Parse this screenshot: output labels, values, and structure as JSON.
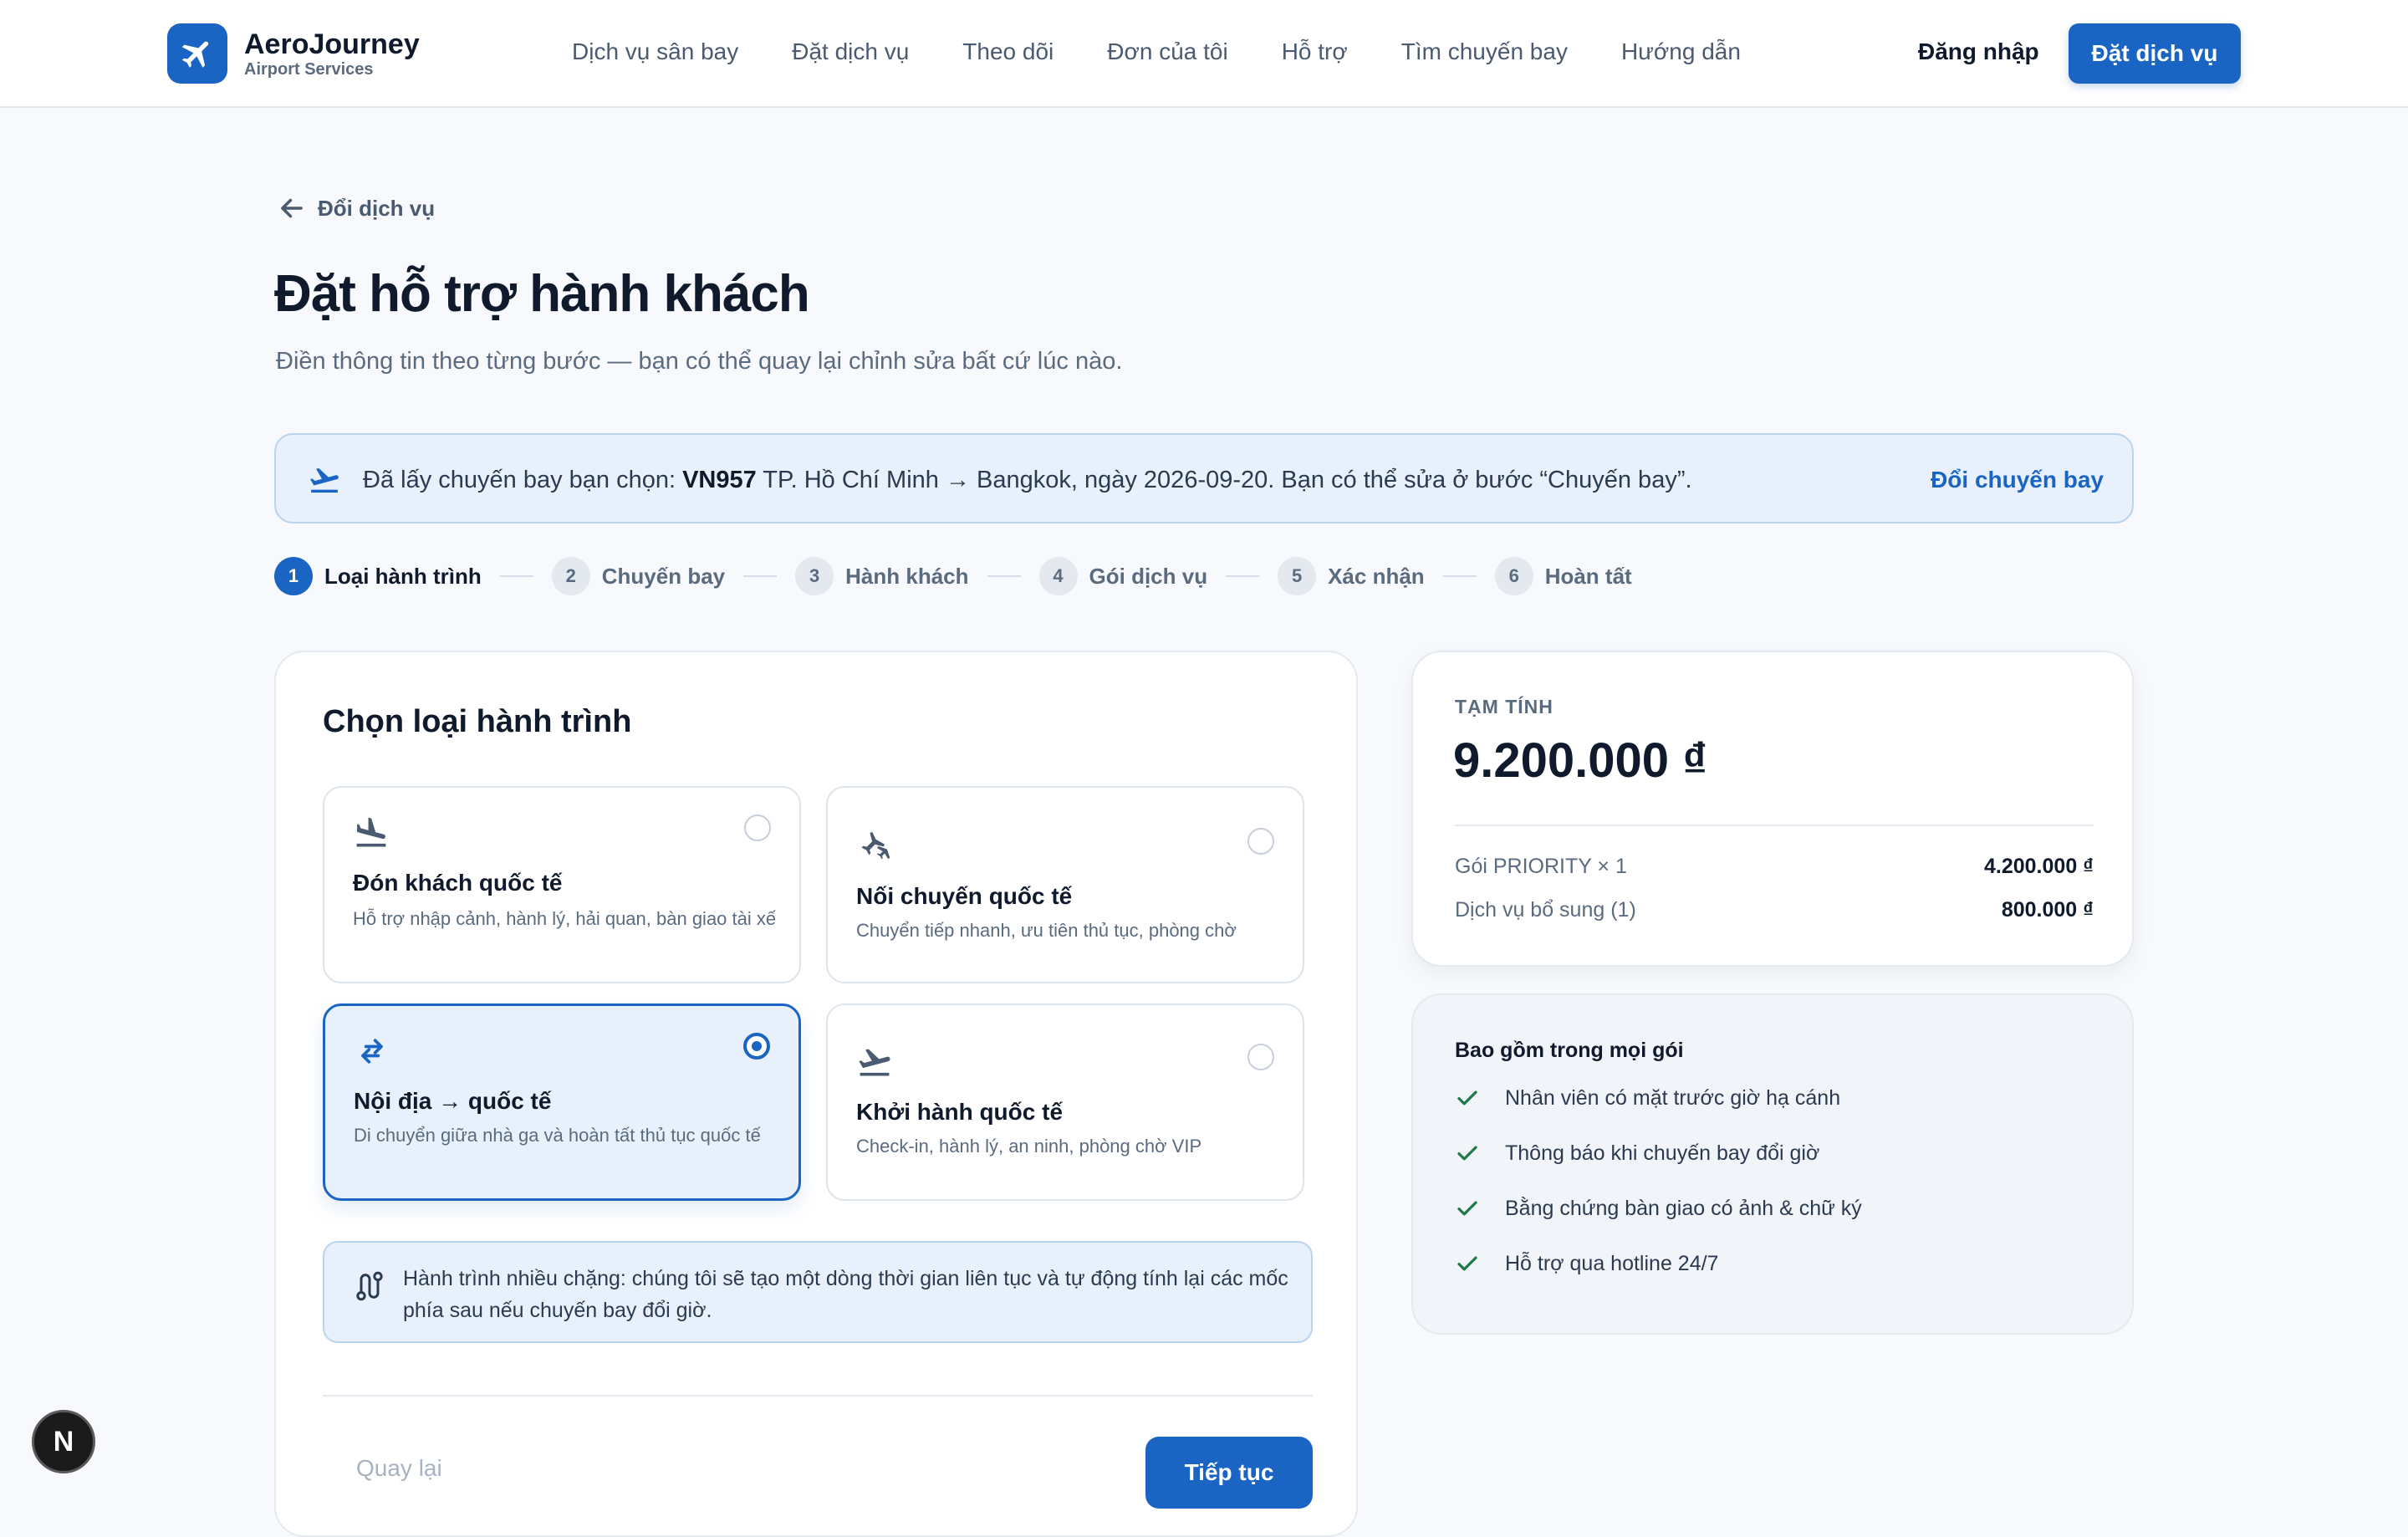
{
  "header": {
    "brand_name": "AeroJourney",
    "brand_sub": "Airport Services",
    "nav": [
      "Dịch vụ sân bay",
      "Đặt dịch vụ",
      "Theo dõi",
      "Đơn của tôi",
      "Hỗ trợ",
      "Tìm chuyến bay",
      "Hướng dẫn"
    ],
    "login": "Đăng nhập",
    "cta": "Đặt dịch vụ"
  },
  "page": {
    "back_label": "Đổi dịch vụ",
    "title": "Đặt hỗ trợ hành khách",
    "subtitle": "Điền thông tin theo từng bước — bạn có thể quay lại chỉnh sửa bất cứ lúc nào."
  },
  "banner": {
    "prefix": "Đã lấy chuyến bay bạn chọn: ",
    "flight": "VN957",
    "suffix": " TP. Hồ Chí Minh → Bangkok, ngày 2026-09-20. Bạn có thể sửa ở bước “Chuyến bay”.",
    "link": "Đổi chuyến bay"
  },
  "steps": [
    {
      "num": "1",
      "label": "Loại hành trình"
    },
    {
      "num": "2",
      "label": "Chuyến bay"
    },
    {
      "num": "3",
      "label": "Hành khách"
    },
    {
      "num": "4",
      "label": "Gói dịch vụ"
    },
    {
      "num": "5",
      "label": "Xác nhận"
    },
    {
      "num": "6",
      "label": "Hoàn tất"
    }
  ],
  "card": {
    "title": "Chọn loại hành trình",
    "options": [
      {
        "title": "Đón khách quốc tế",
        "desc": "Hỗ trợ nhập cảnh, hành lý, hải quan, bàn giao tài xế",
        "icon": "plane-landing-icon"
      },
      {
        "title": "Nối chuyến quốc tế",
        "desc": "Chuyển tiếp nhanh, ưu tiên thủ tục, phòng chờ",
        "icon": "connecting-flight-icon"
      },
      {
        "title": "Nội địa → quốc tế",
        "desc": "Di chuyển giữa nhà ga và hoàn tất thủ tục quốc tế",
        "icon": "swap-arrows-icon"
      },
      {
        "title": "Khởi hành quốc tế",
        "desc": "Check-in, hành lý, an ninh, phòng chờ VIP",
        "icon": "plane-takeoff-icon"
      }
    ],
    "selected_index": 2,
    "note": "Hành trình nhiều chặng: chúng tôi sẽ tạo một dòng thời gian liên tục và tự động tính lại các mốc phía sau nếu chuyến bay đổi giờ.",
    "back_button": "Quay lại",
    "next_button": "Tiếp tục"
  },
  "summary": {
    "label": "TẠM TÍNH",
    "total": "9.200.000 ₫",
    "rows": [
      {
        "label": "Gói PRIORITY × 1",
        "value": "4.200.000 ₫"
      },
      {
        "label": "Dịch vụ bổ sung (1)",
        "value": "800.000 ₫"
      }
    ]
  },
  "included": {
    "title": "Bao gồm trong mọi gói",
    "items": [
      "Nhân viên có mặt trước giờ hạ cánh",
      "Thông báo khi chuyến bay đổi giờ",
      "Bằng chứng bàn giao có ảnh & chữ ký",
      "Hỗ trợ qua hotline 24/7"
    ]
  },
  "fab_label": "N",
  "colors": {
    "accent": "#1a64c4",
    "check": "#1f7a4a",
    "text": "#0f1b2d"
  }
}
